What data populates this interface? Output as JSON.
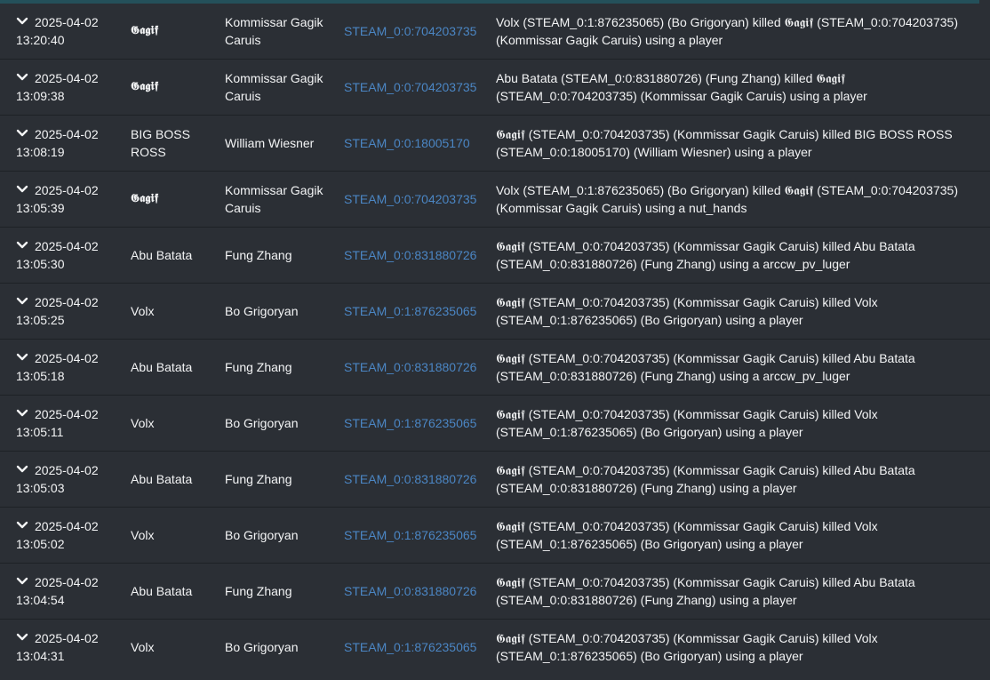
{
  "colors": {
    "background": "#2b2f35",
    "text": "#f3f4f5",
    "link": "#4b86c4",
    "top_border": "#24505a",
    "row_separator": "#1d2125"
  },
  "icons": {
    "expand": "chevron-down-icon"
  },
  "rows": [
    {
      "date": "2025-04-02",
      "time": "13:20:40",
      "player_name": "𝕲𝖆𝖌𝖎𝖋",
      "character_name": "Kommissar Gagik Caruis",
      "steam_id": "STEAM_0:0:704203735",
      "description": "Volx (STEAM_0:1:876235065) (Bo Grigoryan) killed 𝕲𝖆𝖌𝖎𝖋 (STEAM_0:0:704203735) (Kommissar Gagik Caruis) using a player"
    },
    {
      "date": "2025-04-02",
      "time": "13:09:38",
      "player_name": "𝕲𝖆𝖌𝖎𝖋",
      "character_name": "Kommissar Gagik Caruis",
      "steam_id": "STEAM_0:0:704203735",
      "description": "Abu Batata (STEAM_0:0:831880726) (Fung Zhang) killed 𝕲𝖆𝖌𝖎𝖋 (STEAM_0:0:704203735) (Kommissar Gagik Caruis) using a player"
    },
    {
      "date": "2025-04-02",
      "time": "13:08:19",
      "player_name": "BIG BOSS ROSS",
      "character_name": "William Wiesner",
      "steam_id": "STEAM_0:0:18005170",
      "description": "𝕲𝖆𝖌𝖎𝖋 (STEAM_0:0:704203735) (Kommissar Gagik Caruis) killed BIG BOSS ROSS (STEAM_0:0:18005170) (William Wiesner) using a player"
    },
    {
      "date": "2025-04-02",
      "time": "13:05:39",
      "player_name": "𝕲𝖆𝖌𝖎𝖋",
      "character_name": "Kommissar Gagik Caruis",
      "steam_id": "STEAM_0:0:704203735",
      "description": "Volx (STEAM_0:1:876235065) (Bo Grigoryan) killed 𝕲𝖆𝖌𝖎𝖋 (STEAM_0:0:704203735) (Kommissar Gagik Caruis) using a nut_hands"
    },
    {
      "date": "2025-04-02",
      "time": "13:05:30",
      "player_name": "Abu Batata",
      "character_name": "Fung Zhang",
      "steam_id": "STEAM_0:0:831880726",
      "description": "𝕲𝖆𝖌𝖎𝖋 (STEAM_0:0:704203735) (Kommissar Gagik Caruis) killed Abu Batata (STEAM_0:0:831880726) (Fung Zhang) using a arccw_pv_luger"
    },
    {
      "date": "2025-04-02",
      "time": "13:05:25",
      "player_name": "Volx",
      "character_name": "Bo Grigoryan",
      "steam_id": "STEAM_0:1:876235065",
      "description": "𝕲𝖆𝖌𝖎𝖋 (STEAM_0:0:704203735) (Kommissar Gagik Caruis) killed Volx (STEAM_0:1:876235065) (Bo Grigoryan) using a player"
    },
    {
      "date": "2025-04-02",
      "time": "13:05:18",
      "player_name": "Abu Batata",
      "character_name": "Fung Zhang",
      "steam_id": "STEAM_0:0:831880726",
      "description": "𝕲𝖆𝖌𝖎𝖋 (STEAM_0:0:704203735) (Kommissar Gagik Caruis) killed Abu Batata (STEAM_0:0:831880726) (Fung Zhang) using a arccw_pv_luger"
    },
    {
      "date": "2025-04-02",
      "time": "13:05:11",
      "player_name": "Volx",
      "character_name": "Bo Grigoryan",
      "steam_id": "STEAM_0:1:876235065",
      "description": "𝕲𝖆𝖌𝖎𝖋 (STEAM_0:0:704203735) (Kommissar Gagik Caruis) killed Volx (STEAM_0:1:876235065) (Bo Grigoryan) using a player"
    },
    {
      "date": "2025-04-02",
      "time": "13:05:03",
      "player_name": "Abu Batata",
      "character_name": "Fung Zhang",
      "steam_id": "STEAM_0:0:831880726",
      "description": "𝕲𝖆𝖌𝖎𝖋 (STEAM_0:0:704203735) (Kommissar Gagik Caruis) killed Abu Batata (STEAM_0:0:831880726) (Fung Zhang) using a player"
    },
    {
      "date": "2025-04-02",
      "time": "13:05:02",
      "player_name": "Volx",
      "character_name": "Bo Grigoryan",
      "steam_id": "STEAM_0:1:876235065",
      "description": "𝕲𝖆𝖌𝖎𝖋 (STEAM_0:0:704203735) (Kommissar Gagik Caruis) killed Volx (STEAM_0:1:876235065) (Bo Grigoryan) using a player"
    },
    {
      "date": "2025-04-02",
      "time": "13:04:54",
      "player_name": "Abu Batata",
      "character_name": "Fung Zhang",
      "steam_id": "STEAM_0:0:831880726",
      "description": "𝕲𝖆𝖌𝖎𝖋 (STEAM_0:0:704203735) (Kommissar Gagik Caruis) killed Abu Batata (STEAM_0:0:831880726) (Fung Zhang) using a player"
    },
    {
      "date": "2025-04-02",
      "time": "13:04:31",
      "player_name": "Volx",
      "character_name": "Bo Grigoryan",
      "steam_id": "STEAM_0:1:876235065",
      "description": "𝕲𝖆𝖌𝖎𝖋 (STEAM_0:0:704203735) (Kommissar Gagik Caruis) killed Volx (STEAM_0:1:876235065) (Bo Grigoryan) using a player"
    }
  ]
}
